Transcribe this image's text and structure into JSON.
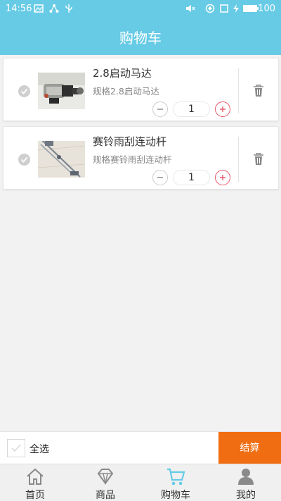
{
  "status_bar": {
    "time": "14:56",
    "battery": "100"
  },
  "nav": {
    "title": "购物车"
  },
  "cart": {
    "items": [
      {
        "name": "2.8启动马达",
        "spec": "规格2.8启动马达",
        "quantity": "1"
      },
      {
        "name": "赛铃雨刮连动杆",
        "spec": "规格赛铃雨刮连动杆",
        "quantity": "1"
      }
    ]
  },
  "footer": {
    "select_all": "全选",
    "checkout": "结算"
  },
  "tabs": [
    {
      "label": "首页",
      "icon": "home-icon"
    },
    {
      "label": "商品",
      "icon": "diamond-icon"
    },
    {
      "label": "购物车",
      "icon": "cart-icon"
    },
    {
      "label": "我的",
      "icon": "user-icon"
    }
  ],
  "colors": {
    "header": "#67cbe6",
    "checkout": "#f06e11",
    "plus": "#e5586a",
    "active_tab": "#67cbe6"
  }
}
